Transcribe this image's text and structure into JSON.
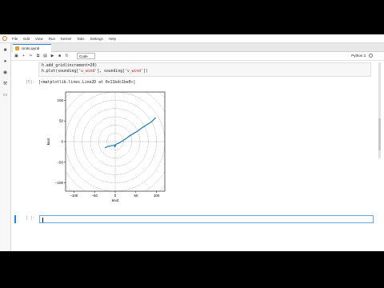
{
  "menu": [
    "File",
    "Edit",
    "View",
    "Run",
    "Kernel",
    "Tabs",
    "Settings",
    "Help"
  ],
  "tab": {
    "title": "Units.ipynb"
  },
  "toolbar": {
    "cell_type": "Code",
    "kernel": "Python 3"
  },
  "cell1": {
    "line1": "h.add_grid(increment=20)",
    "line2_pre": "h.plot(sounding[",
    "line2_s1": "'u_wind'",
    "line2_mid": "], sounding[",
    "line2_s2": "'v_wind'",
    "line2_post": "])"
  },
  "output": {
    "prompt": "[5]:",
    "text": "[<matplotlib.lines.Line2D at 0x11bdc1be0>]"
  },
  "cell2": {
    "prompt": "[ ]:"
  },
  "chart_data": {
    "type": "line",
    "xlabel": "knot",
    "ylabel": "knot",
    "xlim": [
      -120,
      120
    ],
    "ylim": [
      -120,
      120
    ],
    "xticks": [
      -100,
      -50,
      0,
      50,
      100
    ],
    "yticks": [
      -100,
      -50,
      0,
      50,
      100
    ],
    "xtick_labels": [
      "−100",
      "−50",
      "0",
      "50",
      "100"
    ],
    "ytick_labels": [
      "−100",
      "−50",
      "0",
      "50",
      "100"
    ],
    "grid_rings": [
      20,
      40,
      60,
      80,
      100,
      120,
      140,
      160
    ],
    "series": [
      {
        "color": "#1f77b4",
        "x": [
          -25,
          -18,
          -10,
          -4,
          0,
          -2,
          3,
          10,
          18,
          27,
          35,
          45,
          55,
          64,
          72,
          80,
          88,
          93,
          98
        ],
        "y": [
          -15,
          -12,
          -10,
          -9,
          -8,
          -14,
          -6,
          -3,
          2,
          8,
          14,
          20,
          26,
          33,
          38,
          43,
          48,
          53,
          58
        ]
      }
    ]
  }
}
